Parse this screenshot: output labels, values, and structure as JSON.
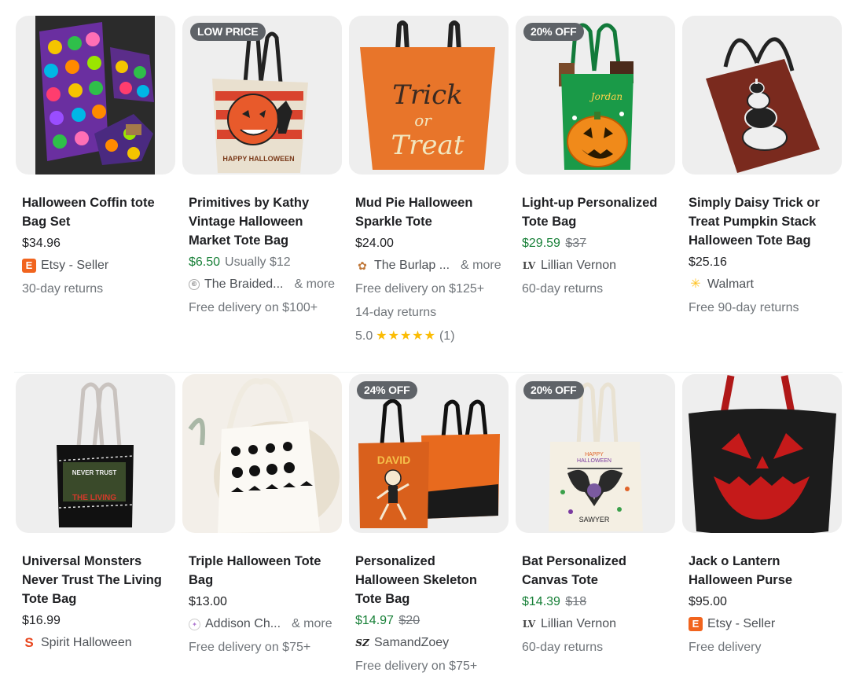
{
  "products": [
    {
      "title": "Halloween Coffin tote Bag Set",
      "price": "$34.96",
      "merchant": "Etsy - Seller",
      "merchant_icon": "etsy-icon",
      "extra": [
        "30-day returns"
      ]
    },
    {
      "badge": "LOW PRICE",
      "title": "Primitives by Kathy Vintage Halloween Market Tote Bag",
      "price": "$6.50",
      "sale": true,
      "usually": "Usually $12",
      "merchant": "The Braided...",
      "more": "& more",
      "merchant_icon": "store-icon",
      "extra": [
        "Free delivery on $100+"
      ]
    },
    {
      "title": "Mud Pie Halloween Sparkle Tote",
      "price": "$24.00",
      "merchant": "The Burlap ...",
      "more": "& more",
      "merchant_icon": "burlap-icon",
      "extra": [
        "Free delivery on $125+",
        "14-day returns"
      ],
      "rating": "5.0",
      "stars": "★★★★★",
      "reviews": "(1)"
    },
    {
      "badge": "20% OFF",
      "title": "Light-up Personalized Tote Bag",
      "price": "$29.59",
      "sale": true,
      "old": "$37",
      "merchant": "Lillian Vernon",
      "merchant_icon": "lv-icon",
      "extra": [
        "60-day returns"
      ]
    },
    {
      "title": "Simply Daisy Trick or Treat Pumpkin Stack Halloween Tote Bag",
      "price": "$25.16",
      "merchant": "Walmart",
      "merchant_icon": "walmart-icon",
      "extra": [
        "Free 90-day returns"
      ]
    },
    {
      "title": "Universal Monsters Never Trust The Living Tote Bag",
      "price": "$16.99",
      "merchant": "Spirit Halloween",
      "merchant_icon": "spirit-icon",
      "extra": []
    },
    {
      "title": "Triple Halloween Tote Bag",
      "price": "$13.00",
      "merchant": "Addison Ch...",
      "more": "& more",
      "merchant_icon": "addison-icon",
      "extra": [
        "Free delivery on $75+"
      ]
    },
    {
      "badge": "24% OFF",
      "title": "Personalized Halloween Skeleton Tote Bag",
      "price": "$14.97",
      "sale": true,
      "old": "$20",
      "merchant": "SamandZoey",
      "merchant_icon": "sz-icon",
      "extra": [
        "Free delivery on $75+"
      ]
    },
    {
      "badge": "20% OFF",
      "title": "Bat Personalized Canvas Tote",
      "price": "$14.39",
      "sale": true,
      "old": "$18",
      "merchant": "Lillian Vernon",
      "merchant_icon": "lv-icon",
      "extra": [
        "60-day returns"
      ]
    },
    {
      "title": "Jack o Lantern Halloween Purse",
      "price": "$95.00",
      "merchant": "Etsy - Seller",
      "merchant_icon": "etsy-icon",
      "extra": [
        "Free delivery"
      ]
    }
  ],
  "image_text": {
    "p1": "HAPPY HALLOWEEN",
    "p2a": "Trick",
    "p2b": "or",
    "p2c": "Treat",
    "p3": "Jordan",
    "p5a": "NEVER TRUST",
    "p5b": "THE LIVING",
    "p7": "DAVID",
    "p8a": "HAPPY",
    "p8b": "HALLOWEEN",
    "p8c": "SAWYER"
  },
  "merchant_glyphs": {
    "etsy": "E",
    "sz": "SZ",
    "lv": "LV",
    "spirit": "S"
  },
  "colors": {
    "sale_green": "#188038",
    "star": "#fbbc04",
    "badge_bg": "#5f6368",
    "etsy": "#f1641e",
    "walmart": "#ffc220",
    "spirit": "#e8461e"
  }
}
